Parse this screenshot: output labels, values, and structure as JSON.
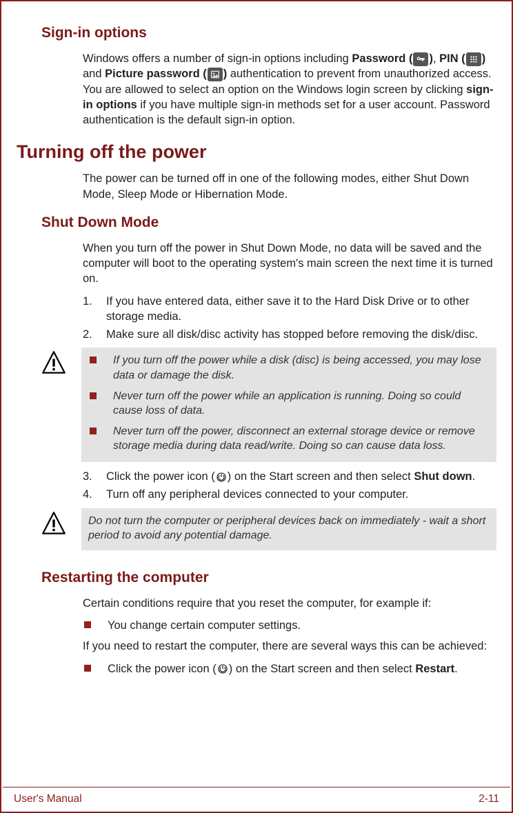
{
  "sections": {
    "signin": {
      "heading": "Sign-in options",
      "p1_a": "Windows offers a number of sign-in options including ",
      "bold1": "Password (",
      "mid1": ")",
      "p1_b": ", ",
      "bold2": "PIN (",
      "mid2": ")",
      "p1_c": " and ",
      "bold3": "Picture password (",
      "mid3": ")",
      "p1_d": " authentication to prevent from unauthorized access. You are allowed to select an option on the Windows login screen by clicking ",
      "bold4": "sign-in options",
      "p1_e": " if you have multiple sign-in methods set for a user account. Password authentication is the default sign-in option."
    },
    "poweroff": {
      "heading": "Turning off the power",
      "intro": "The power can be turned off in one of the following modes, either Shut Down Mode, Sleep Mode or Hibernation Mode."
    },
    "shutdown": {
      "heading": "Shut Down Mode",
      "intro": "When you turn off the power in Shut Down Mode, no data will be saved and the computer will boot to the operating system's main screen the next time it is turned on.",
      "steps12": [
        {
          "n": "1.",
          "t": "If you have entered data, either save it to the Hard Disk Drive or to other storage media."
        },
        {
          "n": "2.",
          "t": "Make sure all disk/disc activity has stopped before removing the disk/disc."
        }
      ],
      "warn1": [
        "If you turn off the power while a disk (disc) is being accessed, you may lose data or damage the disk.",
        "Never turn off the power while an application is running. Doing so could cause loss of data.",
        "Never turn off the power, disconnect an external storage device or remove storage media during data read/write. Doing so can cause data loss."
      ],
      "step3_a": "Click the power icon (",
      "step3_b": ") on the Start screen and then select ",
      "step3_bold": "Shut down",
      "step3_c": ".",
      "step4": "Turn off any peripheral devices connected to your computer.",
      "warn2": "Do not turn the computer or peripheral devices back on immediately - wait a short period to avoid any potential damage."
    },
    "restart": {
      "heading": "Restarting the computer",
      "intro": "Certain conditions require that you reset the computer, for example if:",
      "bullet1": "You change certain computer settings.",
      "p2": "If you need to restart the computer, there are several ways this can be achieved:",
      "bullet2_a": "Click the power icon (",
      "bullet2_b": ") on the Start screen and then select ",
      "bullet2_bold": "Restart",
      "bullet2_c": "."
    }
  },
  "footer": {
    "left": "User's Manual",
    "right": "2-11"
  }
}
